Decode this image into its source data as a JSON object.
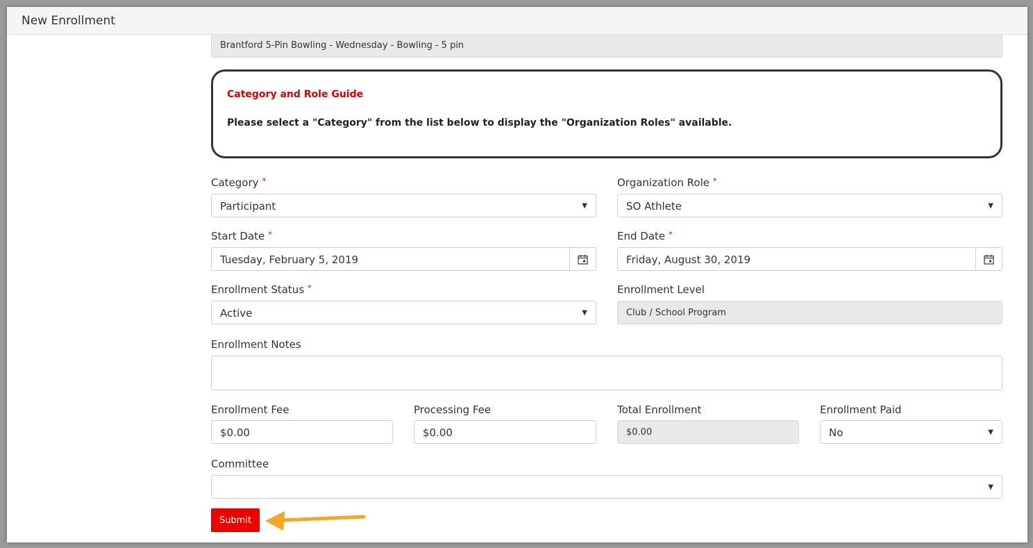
{
  "header": {
    "title": "New Enrollment"
  },
  "program": {
    "value": "Brantford 5-Pin Bowling - Wednesday - Bowling - 5 pin"
  },
  "guide": {
    "title": "Category and Role Guide",
    "text": "Please select a \"Category\" from the list below to display the \"Organization Roles\" available."
  },
  "form": {
    "required_mark": "*",
    "category": {
      "label": "Category",
      "value": "Participant"
    },
    "organization_role": {
      "label": "Organization Role",
      "value": "SO Athlete"
    },
    "start_date": {
      "label": "Start Date",
      "value": "Tuesday, February 5, 2019"
    },
    "end_date": {
      "label": "End Date",
      "value": "Friday, August 30, 2019"
    },
    "enrollment_status": {
      "label": "Enrollment Status",
      "value": "Active"
    },
    "enrollment_level": {
      "label": "Enrollment Level",
      "value": "Club / School Program"
    },
    "enrollment_notes": {
      "label": "Enrollment Notes",
      "value": ""
    },
    "enrollment_fee": {
      "label": "Enrollment Fee",
      "value": "$0.00"
    },
    "processing_fee": {
      "label": "Processing Fee",
      "value": "$0.00"
    },
    "total_enrollment": {
      "label": "Total Enrollment",
      "value": "$0.00"
    },
    "enrollment_paid": {
      "label": "Enrollment Paid",
      "value": "No"
    },
    "committee": {
      "label": "Committee",
      "value": ""
    },
    "submit_label": "Submit"
  },
  "icons": {
    "dropdown": "chevron-down-icon",
    "calendar": "calendar-icon",
    "annotation": "arrow-annotation-icon"
  },
  "colors": {
    "accent_red": "#d40000",
    "button_red": "#ef0000",
    "arrow_orange": "#f5a623"
  }
}
